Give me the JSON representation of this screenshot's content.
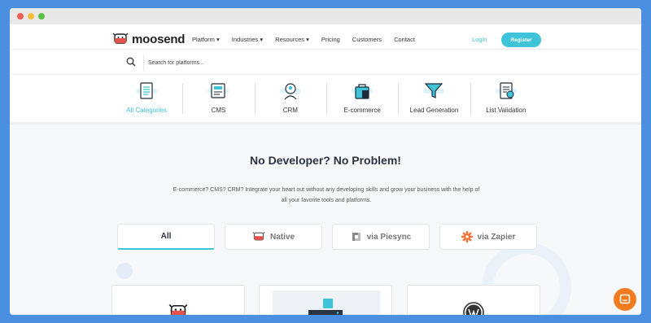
{
  "header": {
    "logo_text": "moosend",
    "menu": [
      "Platform ▾",
      "Industries ▾",
      "Resources ▾",
      "Pricing",
      "Customers",
      "Contact"
    ],
    "login_label": "Login",
    "register_label": "Register"
  },
  "search": {
    "placeholder": "Search for platforms..."
  },
  "categories": [
    {
      "label": "All Categories",
      "icon": "list-icon"
    },
    {
      "label": "CMS",
      "icon": "cms-icon"
    },
    {
      "label": "CRM",
      "icon": "crm-icon"
    },
    {
      "label": "E-commerce",
      "icon": "shopping-bag-icon"
    },
    {
      "label": "Lead Generation",
      "icon": "funnel-icon"
    },
    {
      "label": "List Validation",
      "icon": "checklist-icon"
    }
  ],
  "hero": {
    "title": "No Developer? No Problem!",
    "subtitle": "E-commerce? CMS? CRM? Integrate your heart out without any developing skills and grow your business with the help of all your favorite tools and platforms."
  },
  "filters": [
    "All",
    "Native",
    "via Piesync",
    "via Zapier"
  ],
  "colors": {
    "accent": "#3ec3d8",
    "chat": "#f27b20",
    "background": "#4a8fe0"
  }
}
